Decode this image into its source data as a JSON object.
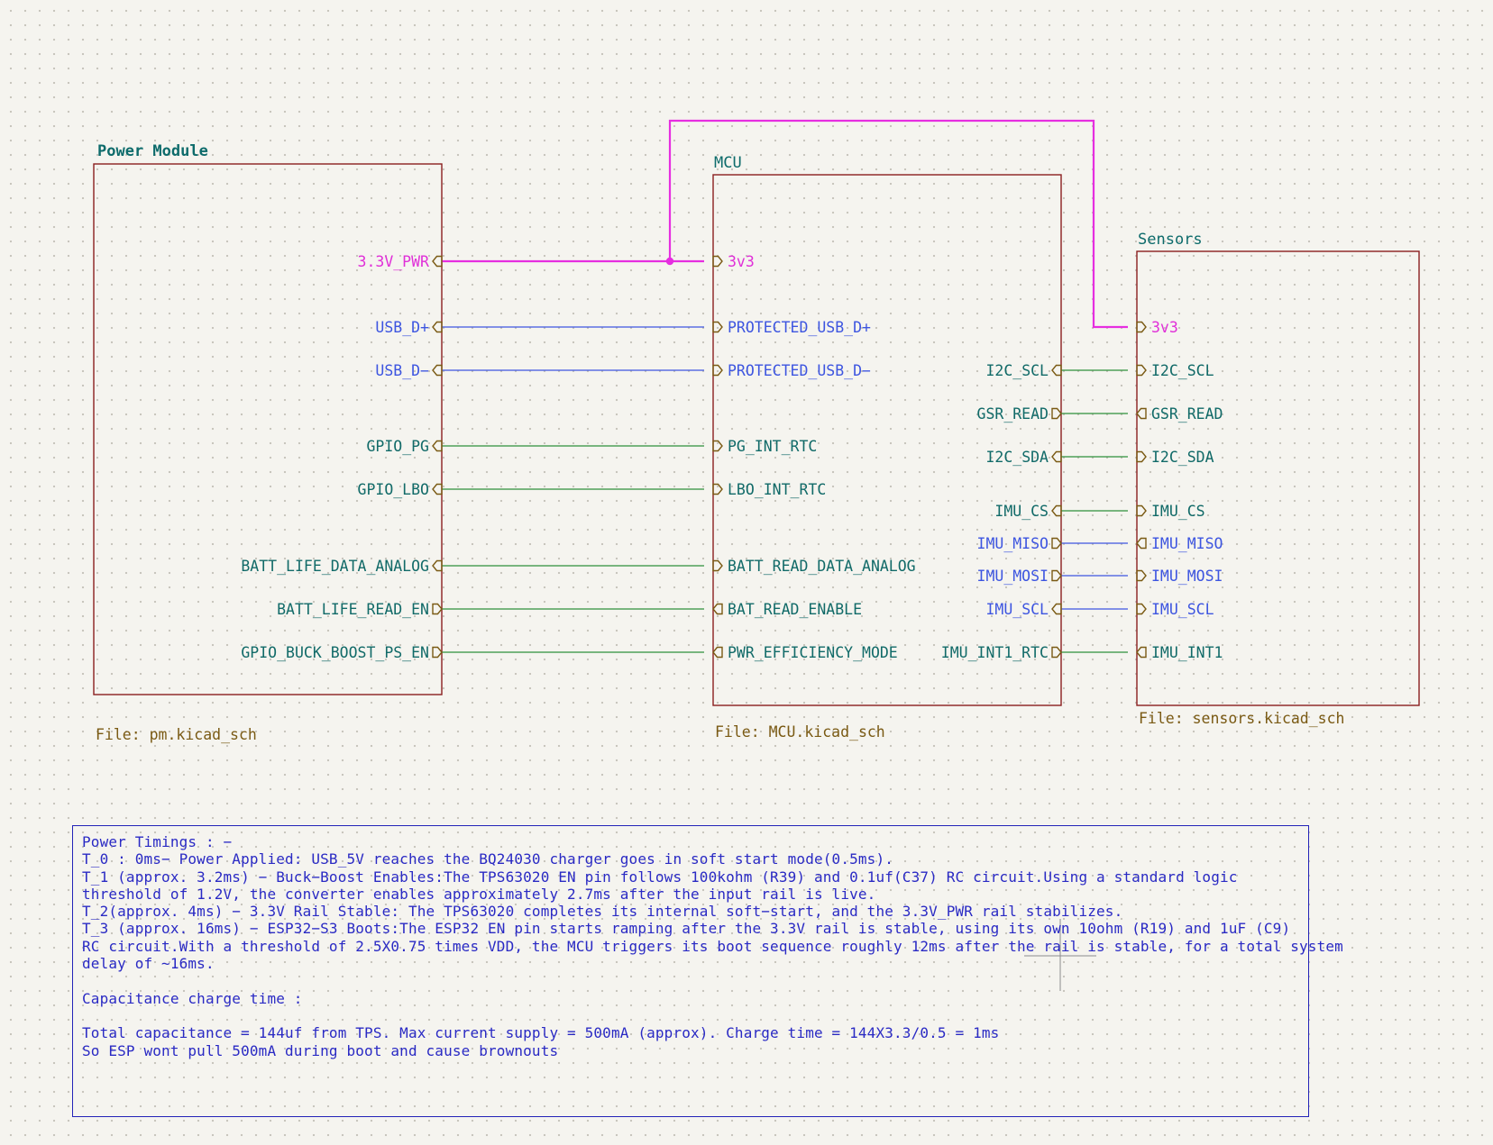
{
  "colors": {
    "sheet_border": "#8a1f1f",
    "sheet_title": "#0d6b6b",
    "file_label": "#7a5a14",
    "power_net": "#e62ee0",
    "usb_spi_net": "#3d55e0",
    "signal_net": "#2f8f3b",
    "label_power": "#e030d8",
    "label_blue": "#3d55e0",
    "label_green": "#116a68",
    "note_text": "#2a2ac4"
  },
  "sheets": {
    "power_module": {
      "title": "Power Module",
      "file": "File: pm.kicad_sch",
      "pins": [
        "3.3V_PWR",
        "USB_D+",
        "USB_D−",
        "GPIO_PG",
        "GPIO_LBO",
        "BATT_LIFE_DATA_ANALOG",
        "BATT_LIFE_READ_EN",
        "GPIO_BUCK_BOOST_PS_EN"
      ]
    },
    "mcu": {
      "title": "MCU",
      "file": "File: MCU.kicad_sch",
      "left_pins": [
        "3v3",
        "PROTECTED_USB_D+",
        "PROTECTED_USB_D−",
        "PG_INT_RTC",
        "LBO_INT_RTC",
        "BATT_READ_DATA_ANALOG",
        "BAT_READ_ENABLE",
        "PWR_EFFICIENCY_MODE"
      ],
      "right_pins": [
        "I2C_SCL",
        "GSR_READ",
        "I2C_SDA",
        "IMU_CS",
        "IMU_MISO",
        "IMU_MOSI",
        "IMU_SCL",
        "IMU_INT1_RTC"
      ]
    },
    "sensors": {
      "title": "Sensors",
      "file": "File: sensors.kicad_sch",
      "pins": [
        "3v3",
        "I2C_SCL",
        "GSR_READ",
        "I2C_SDA",
        "IMU_CS",
        "IMU_MISO",
        "IMU_MOSI",
        "IMU_SCL",
        "IMU_INT1"
      ]
    }
  },
  "note": {
    "lines": [
      "Power Timings : −",
      "T_0 : 0ms− Power Applied: USB_5V reaches the BQ24030 charger goes in soft start mode(0.5ms).",
      "T_1 (approx. 3.2ms) − Buck−Boost Enables:The TPS63020 EN pin follows 100kohm (R39) and 0.1uf(C37) RC circuit.Using a standard logic",
      "threshold of 1.2V, the converter enables approximately 2.7ms after the input rail is live.",
      "T_2(approx. 4ms) − 3.3V Rail Stable: The TPS63020 completes its internal soft−start, and the 3.3V_PWR rail stabilizes.",
      "T_3 (approx. 16ms) − ESP32−S3 Boots:The ESP32 EN pin starts ramping after the 3.3V rail is stable, using its own 10ohm (R19) and 1uF (C9)",
      "RC circuit.With a threshold of 2.5X0.75 times VDD, the MCU triggers its boot sequence roughly 12ms after the rail is stable, for a total system",
      "delay of ~16ms.",
      "",
      "Capacitance charge time :",
      "",
      "Total capacitance = 144uf from TPS. Max current supply = 500mA (approx). Charge time = 144X3.3/0.5 = 1ms",
      "So ESP wont pull 500mA during boot and cause brownouts"
    ]
  }
}
